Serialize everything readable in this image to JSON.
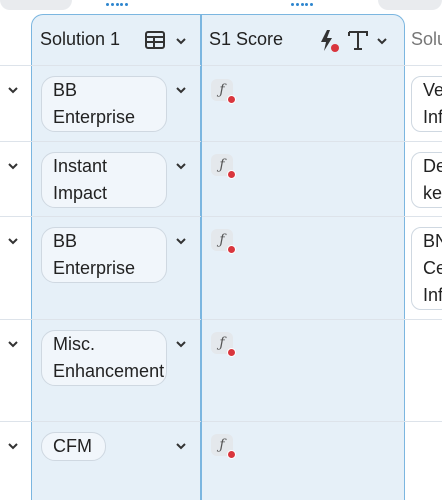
{
  "columns": [
    {
      "title": "Solution 1",
      "type_icon": "table-icon"
    },
    {
      "title": "S1 Score",
      "type_icons": [
        "lightning-icon",
        "text-type-icon"
      ]
    },
    {
      "title": "Solu"
    }
  ],
  "rows": [
    {
      "solution": "BB Enterprise",
      "score_icon": "formula-icon",
      "next_cell": [
        "Ve",
        "Inf"
      ]
    },
    {
      "solution": "Instant Impact",
      "score_icon": "formula-icon",
      "next_cell": [
        "De",
        "ke"
      ]
    },
    {
      "solution": "BB Enterprise",
      "score_icon": "formula-icon",
      "next_cell": [
        "BN",
        "Ce",
        "Inf"
      ]
    },
    {
      "solution": "Misc. Enhancement",
      "score_icon": "formula-icon",
      "next_cell": []
    },
    {
      "solution": "CFM",
      "score_icon": "formula-icon",
      "next_cell": []
    }
  ],
  "formula_glyph": "ƒ",
  "colors": {
    "selection_bg": "#e6f0f8",
    "selection_border": "#7bb6e0",
    "accent": "#2f86cf",
    "error_dot": "#d9363e"
  }
}
